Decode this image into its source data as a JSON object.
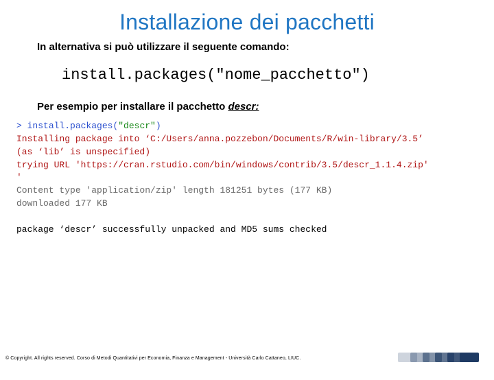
{
  "title": "Installazione dei pacchetti",
  "para1": "In alternativa si può utilizzare il seguente comando:",
  "code_sample": "install.packages(\"nome_pacchetto\")",
  "para2_pre": "Per esempio per installare il pacchetto ",
  "para2_pkg": "descr:",
  "console": {
    "l1_prompt": "> ",
    "l1_fn": "install.packages(",
    "l1_arg": "\"descr\"",
    "l1_close": ")",
    "l2": "Installing package into ‘C:/Users/anna.pozzebon/Documents/R/win-library/3.5’",
    "l3": "(as ‘lib’ is unspecified)",
    "l4": "trying URL 'https://cran.rstudio.com/bin/windows/contrib/3.5/descr_1.1.4.zip'",
    "l5": "Content type 'application/zip' length 181251 bytes (177 KB)",
    "l6": "downloaded 177 KB",
    "l7": "package ‘descr’ successfully unpacked and MD5 sums checked"
  },
  "footer": "© Copyright. All rights reserved. Corso di Metodi Quantitativi per Economia, Finanza e Management - Università Carlo Cattaneo, LIUC."
}
